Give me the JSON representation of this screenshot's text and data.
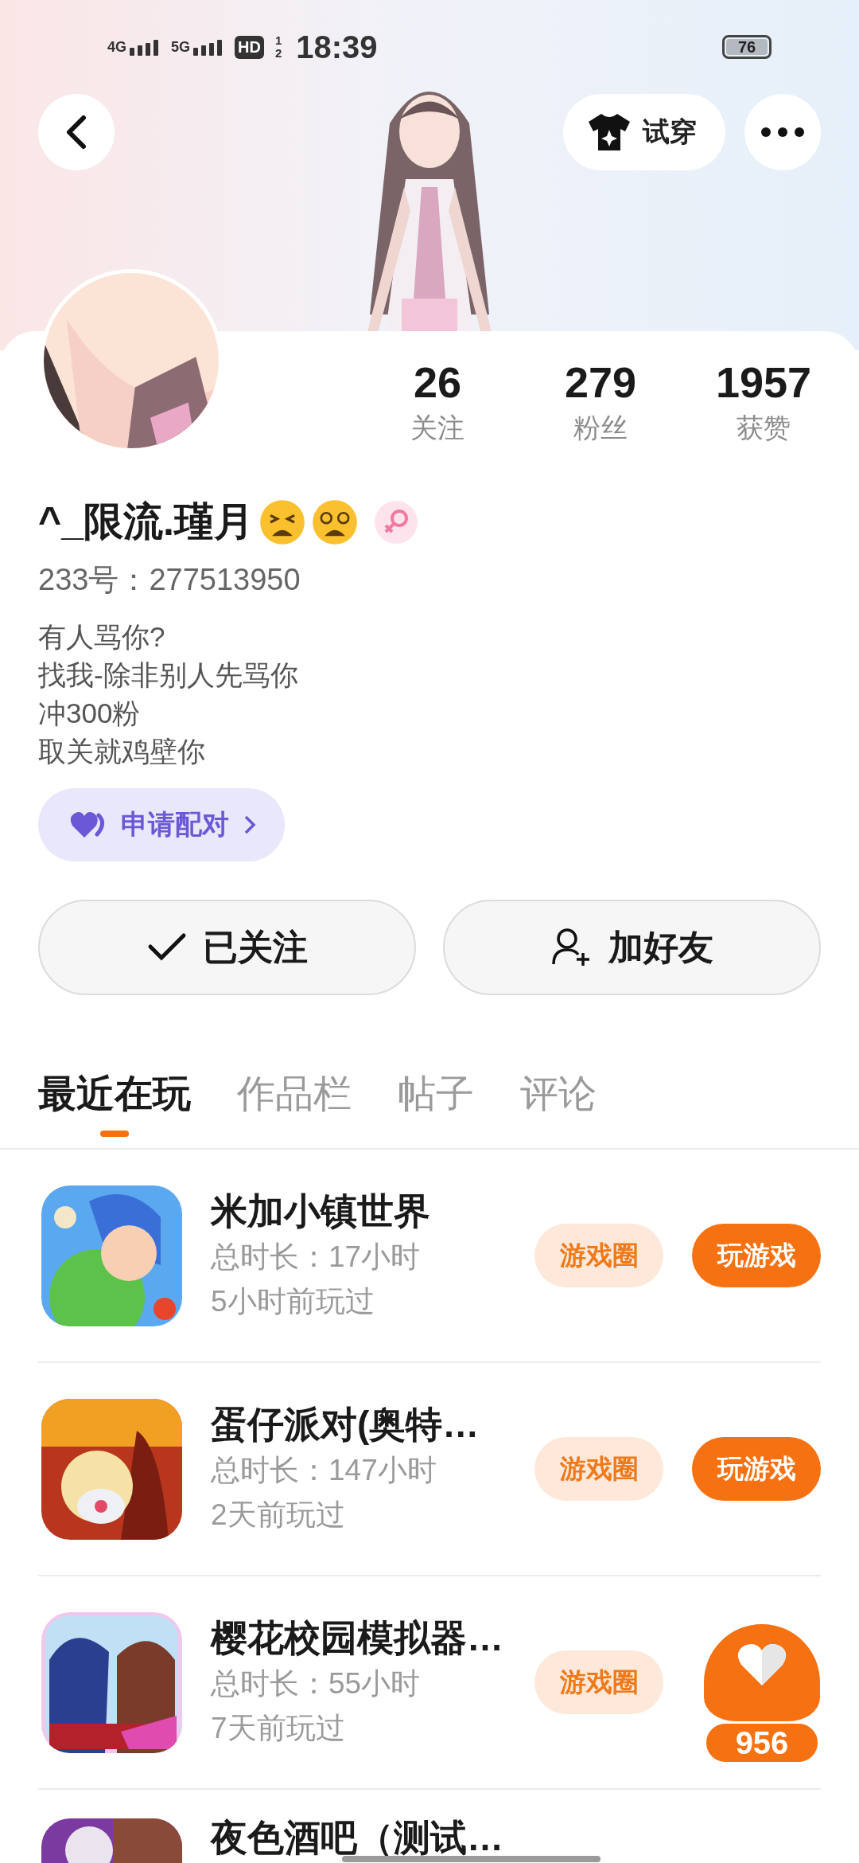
{
  "status_bar": {
    "networks": [
      "4G",
      "5G"
    ],
    "hd": "HD",
    "sim_slots": [
      "1",
      "2"
    ],
    "time": "18:39",
    "battery": "76"
  },
  "top_bar": {
    "try_on": "试穿"
  },
  "stats": [
    {
      "value": "26",
      "label": "关注"
    },
    {
      "value": "279",
      "label": "粉丝"
    },
    {
      "value": "1957",
      "label": "获赞"
    }
  ],
  "profile": {
    "name": "^_限流.瑾月",
    "id_line": "233号：277513950",
    "bio": [
      "有人骂你?",
      "找我-除非别人先骂你",
      "冲300粉",
      "取关就鸡壁你"
    ],
    "pair_button": "申请配对"
  },
  "actions": [
    {
      "kind": "followed",
      "label": "已关注"
    },
    {
      "kind": "add_friend",
      "label": "加好友"
    }
  ],
  "tabs": [
    {
      "label": "最近在玩",
      "selected": true
    },
    {
      "label": "作品栏",
      "selected": false
    },
    {
      "label": "帖子",
      "selected": false
    },
    {
      "label": "评论",
      "selected": false
    }
  ],
  "games": [
    {
      "title": "米加小镇世界",
      "duration": "总时长：17小时",
      "last_played": "5小时前玩过",
      "circle_label": "游戏圈",
      "play_label": "玩游戏"
    },
    {
      "title": "蛋仔派对(奥特…",
      "duration": "总时长：147小时",
      "last_played": "2天前玩过",
      "circle_label": "游戏圈",
      "play_label": "玩游戏"
    },
    {
      "title": "樱花校园模拟器…",
      "duration": "总时长：55小时",
      "last_played": "7天前玩过",
      "circle_label": "游戏圈"
    },
    {
      "title": "夜色酒吧（测试…"
    }
  ],
  "like_widget": {
    "count": "956"
  }
}
